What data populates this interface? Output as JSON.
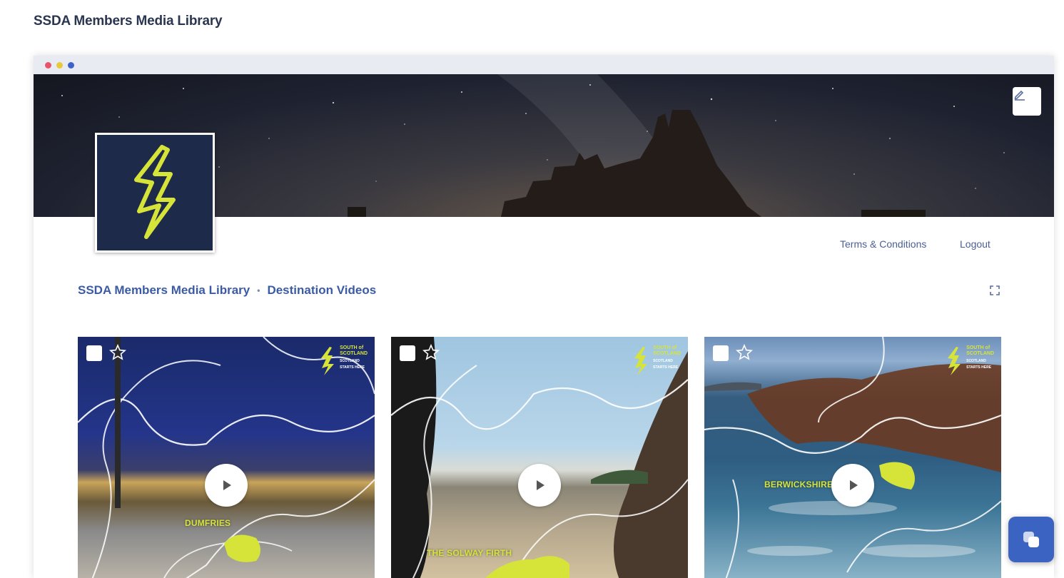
{
  "page": {
    "title": "SSDA Members Media Library"
  },
  "header": {
    "terms_link": "Terms & Conditions",
    "logout_link": "Logout"
  },
  "breadcrumb": {
    "items": [
      "SSDA Members Media Library",
      "Destination Videos"
    ],
    "separator": "•"
  },
  "cards": [
    {
      "region_label": "DUMFRIES",
      "brand_text": [
        "SOUTH of",
        "SCOTLAND"
      ],
      "brand_tagline": [
        "SCOTLAND",
        "STARTS HERE"
      ]
    },
    {
      "region_label": "THE SOLWAY FIRTH",
      "brand_text": [
        "SOUTH of",
        "SCOTLAND"
      ],
      "brand_tagline": [
        "SCOTLAND",
        "STARTS HERE"
      ]
    },
    {
      "region_label": "BERWICKSHIRE",
      "brand_text": [
        "SOUTH of",
        "SCOTLAND"
      ],
      "brand_tagline": [
        "SCOTLAND",
        "STARTS HERE"
      ]
    }
  ],
  "colors": {
    "accent": "#3b5ba5",
    "brand_yellow": "#d6e43a",
    "logo_bg": "#1e2a49",
    "chat_button": "#3a63c2"
  },
  "icons": {
    "edit": "pencil-icon",
    "fullscreen": "fullscreen-icon",
    "play": "play-icon",
    "star": "star-icon",
    "chat": "chat-icon"
  }
}
